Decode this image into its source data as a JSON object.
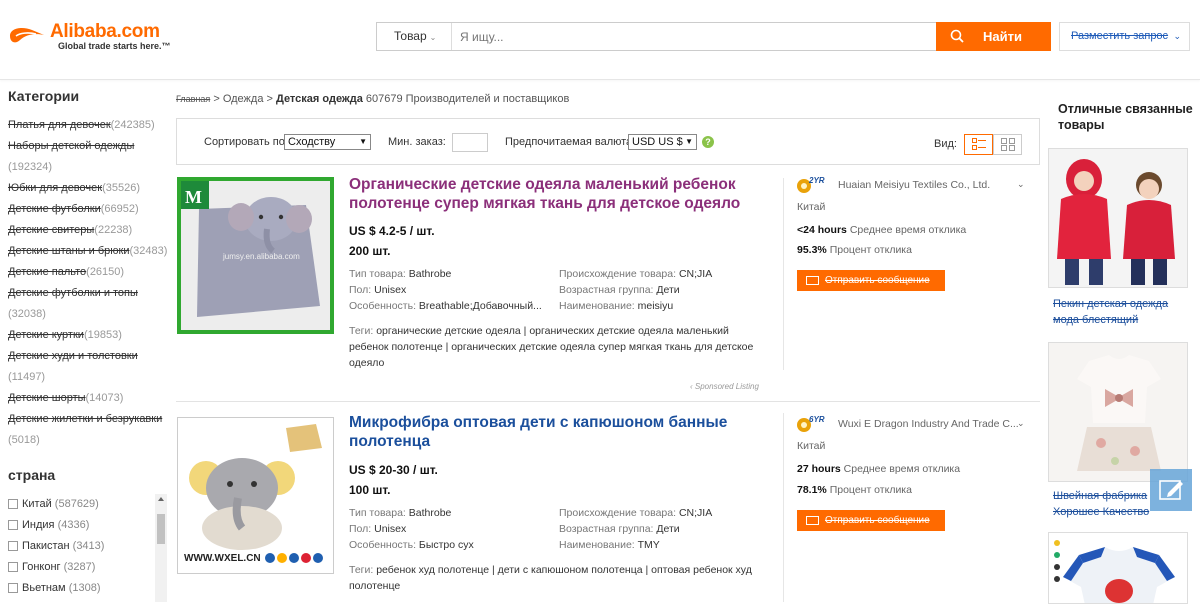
{
  "header": {
    "logo_text": "Alibaba.com",
    "logo_tagline": "Global trade starts here.™",
    "search_category": "Товар",
    "search_placeholder": "Я ищу...",
    "search_button": "Найти",
    "rfq_button": "Разместить запрос"
  },
  "sidebar": {
    "categories_heading": "Категории",
    "categories": [
      {
        "name": "Платья для девочек",
        "count": "(242385)"
      },
      {
        "name": "Наборы детской одежды",
        "count": "(192324)"
      },
      {
        "name": "Юбки для девочек",
        "count": "(35526)"
      },
      {
        "name": "Детские футболки",
        "count": "(66952)"
      },
      {
        "name": "Детские свитеры",
        "count": "(22238)"
      },
      {
        "name": "Детские штаны и брюки",
        "count": "(32483)"
      },
      {
        "name": "Детские пальто",
        "count": "(26150)"
      },
      {
        "name": "Детские футболки и топы",
        "count": "(32038)"
      },
      {
        "name": "Детские куртки",
        "count": "(19853)"
      },
      {
        "name": "Детские худи и толстовки",
        "count": "(11497)"
      },
      {
        "name": "Детские шорты",
        "count": "(14073)"
      },
      {
        "name": "Детские жилетки и безрукавки",
        "count": "(5018)"
      }
    ],
    "country_heading": "страна",
    "countries": [
      {
        "name": "Китай",
        "count": "(587629)"
      },
      {
        "name": "Индия",
        "count": "(4336)"
      },
      {
        "name": "Пакистан",
        "count": "(3413)"
      },
      {
        "name": "Гонконг",
        "count": "(3287)"
      },
      {
        "name": "Вьетнам",
        "count": "(1308)"
      }
    ]
  },
  "breadcrumb": {
    "home": "Главная",
    "sep1": " > ",
    "level1": "Одежда",
    "sep2": " > ",
    "current": "Детская одежда",
    "summary": " 607679 Производителей и поставщиков"
  },
  "toolbar": {
    "sort_label": "Сортировать по",
    "sort_value": "Сходству",
    "min_order_label": "Мин. заказ:",
    "currency_label": "Предпочитаемая валюта",
    "currency_value": "USD US $",
    "help": "?",
    "view_label": "Вид:"
  },
  "products": [
    {
      "title": "Органические детские одеяла маленький ребенок полотенце супер мягкая ткань для детское одеяло",
      "price": "US $ 4.2-5 / шт.",
      "moq": "200 шт.",
      "attrs_left": [
        {
          "k": "Тип товара: ",
          "v": "Bathrobe"
        },
        {
          "k": "Пол: ",
          "v": "Unisex"
        },
        {
          "k": "Особенность: ",
          "v": "Breathable;Добавочный..."
        }
      ],
      "attrs_right": [
        {
          "k": "Происхождение товара: ",
          "v": "CN;JIA"
        },
        {
          "k": "Возрастная группа: ",
          "v": "Дети"
        },
        {
          "k": "Наименование: ",
          "v": "meisiyu"
        }
      ],
      "tags_label": "Теги: ",
      "tags": "органические детские одеяла  |  органических детские одеяла маленький ребенок полотенце  |  органических детские одеяла супер мягкая ткань для детское одеяло",
      "sponsored": "‹ Sponsored Listing",
      "thumb_watermark": "jumsy.en.alibaba.com",
      "supplier": {
        "years": "2YR",
        "name": "Huaian Meisiyu Textiles Co., Ltd.",
        "country": "Китай",
        "response_time": "<24 hours",
        "response_time_label": " Среднее время отклика",
        "response_rate": "95.3%",
        "response_rate_label": " Процент отклика",
        "contact": "Отправить сообщение"
      }
    },
    {
      "title": "Микрофибра оптовая дети с капюшоном банные полотенца",
      "price": "US $ 20-30 / шт.",
      "moq": "100 шт.",
      "attrs_left": [
        {
          "k": "Тип товара: ",
          "v": "Bathrobe"
        },
        {
          "k": "Пол: ",
          "v": "Unisex"
        },
        {
          "k": "Особенность: ",
          "v": "Быстро сух"
        }
      ],
      "attrs_right": [
        {
          "k": "Происхождение товара: ",
          "v": "CN;JIA"
        },
        {
          "k": "Возрастная группа: ",
          "v": "Дети"
        },
        {
          "k": "Наименование: ",
          "v": "TMY"
        }
      ],
      "tags_label": "Теги: ",
      "tags": "ребенок худ полотенце  |  дети с капюшоном полотенца  |  оптовая ребенок худ полотенце",
      "thumb_watermark": "WWW.WXEL.CN",
      "supplier": {
        "years": "6YR",
        "name": "Wuxi E Dragon Industry And Trade C...",
        "country": "Китай",
        "response_time": "27 hours",
        "response_time_label": " Среднее время отклика",
        "response_rate": "78.1%",
        "response_rate_label": " Процент отклика",
        "contact": "Отправить сообщение"
      }
    }
  ],
  "rail": {
    "heading": "Отличные связанные товары",
    "items": [
      {
        "caption": "Пекин детская одежда мода блестящий"
      },
      {
        "caption": "Швейная фабрика Хорошее Качество"
      }
    ]
  },
  "colors": {
    "brand_orange": "#ff6a00",
    "title_purple": "#8b2f7a",
    "title_blue": "#1b4f9c",
    "link_blue": "#1d4f9c"
  }
}
